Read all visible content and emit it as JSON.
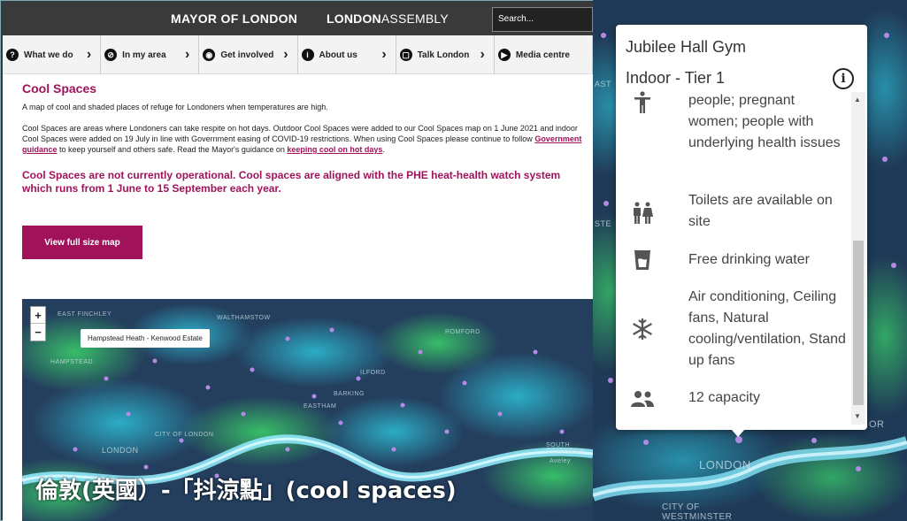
{
  "site": {
    "brand_mayor": "MAYOR OF LONDON",
    "brand_assembly_a": "LONDON",
    "brand_assembly_b": "ASSEMBLY",
    "search_placeholder": "Search...",
    "nav": [
      {
        "label": "What we do",
        "icon": "?"
      },
      {
        "label": "In my area",
        "icon": "⊘"
      },
      {
        "label": "Get involved",
        "icon": "◉"
      },
      {
        "label": "About us",
        "icon": "i"
      },
      {
        "label": "Talk London",
        "icon": "▢"
      },
      {
        "label": "Media centre",
        "icon": "▶"
      }
    ],
    "title": "Cool Spaces",
    "intro": "A map of cool and shaded places of refuge for Londoners when temperatures are high.",
    "body_a": "Cool Spaces are areas where Londoners can take respite on hot days. Outdoor Cool Spaces were added to our Cool Spaces map on 1 June 2021 and indoor Cool Spaces were added on 19 July in line with Government easing of COVID-19 restrictions. When using Cool Spaces please continue to follow ",
    "body_link1": "Government guidance",
    "body_b": " to keep yourself and others safe. Read the Mayor's guidance on ",
    "body_link2": "keeping cool on hot days",
    "body_c": ".",
    "warning": "Cool Spaces are not currently operational. Cool spaces are aligned with the PHE heat-health watch system which runs from 1 June to 15 September each year.",
    "map_button": "View full size map"
  },
  "map_left": {
    "zoom_in": "+",
    "zoom_out": "−",
    "tooltip": "Hampstead Heath - Kenwood Estate",
    "labels": [
      "EAST FINCHLEY",
      "WALTHAMSTOW",
      "ROMFORD",
      "HAMPSTEAD",
      "BARKING",
      "EASTHAM",
      "CITY OF LONDON",
      "LONDON",
      "SOUTH OCKENDON",
      "Aveley",
      "ILFORD"
    ]
  },
  "caption": "倫敦(英國）-「抖涼點」(cool spaces)",
  "popup": {
    "title": "Jubilee Hall Gym",
    "tier": "Indoor - Tier 1",
    "features": [
      {
        "icon": "accessibility-icon",
        "text": "people; pregnant women; people with underlying health issues"
      },
      {
        "icon": "toilets-icon",
        "text": "Toilets are available on site"
      },
      {
        "icon": "water-icon",
        "text": "Free drinking water"
      },
      {
        "icon": "snowflake-icon",
        "text": "Air conditioning, Ceiling fans, Natural cooling/ventilation, Stand up fans"
      },
      {
        "icon": "people-icon",
        "text": "12 capacity"
      }
    ]
  },
  "map_right": {
    "labels": [
      "LONDON",
      "CITY OF WESTMINSTER",
      "OR",
      "AST",
      "STE"
    ]
  }
}
